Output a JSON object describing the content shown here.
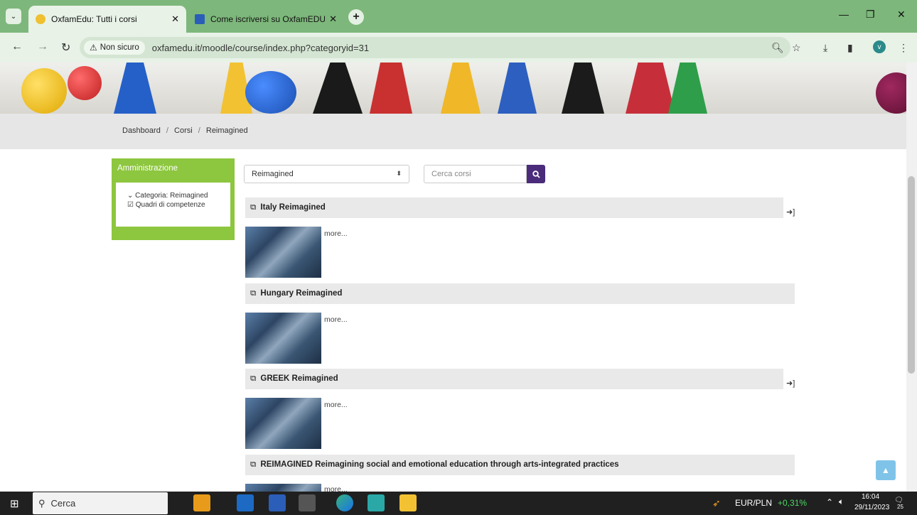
{
  "browser": {
    "tabs": [
      {
        "title": "OxfamEdu: Tutti i corsi",
        "active": true
      },
      {
        "title": "Come iscriversi su OxfamEDU.c",
        "active": false
      }
    ],
    "security_chip": "Non sicuro",
    "url": "oxfamedu.it/moodle/course/index.php?categoryid=31",
    "profile_initial": "v"
  },
  "breadcrumb": {
    "items": [
      "Dashboard",
      "Corsi",
      "Reimagined"
    ],
    "separator": "/"
  },
  "admin_block": {
    "title": "Amministrazione",
    "items": [
      {
        "label": "Categoria: Reimagined",
        "icon": "chevron-down-icon"
      },
      {
        "label": "Quadri di competenze",
        "icon": "checkbox-icon"
      }
    ]
  },
  "category_select": {
    "value": "Reimagined"
  },
  "course_search": {
    "placeholder": "Cerca corsi"
  },
  "courses": [
    {
      "name": "Italy Reimagined",
      "more": "more..."
    },
    {
      "name": "Hungary Reimagined",
      "more": "more..."
    },
    {
      "name": "GREEK Reimagined",
      "more": "more..."
    },
    {
      "name": "REIMAGINED Reimagining social and emotional education through arts-integrated practices",
      "more": "more..."
    }
  ],
  "taskbar": {
    "search_label": "Cerca",
    "ticker_label": "EUR/PLN",
    "ticker_change": "+0,31%",
    "time": "16:04",
    "date": "29/11/2023",
    "notifications": "25"
  },
  "colors": {
    "tabbar": "#7db77b",
    "admin_block": "#8dc63f",
    "search_button": "#4a2c7a",
    "ticker_positive": "#4cd964"
  }
}
